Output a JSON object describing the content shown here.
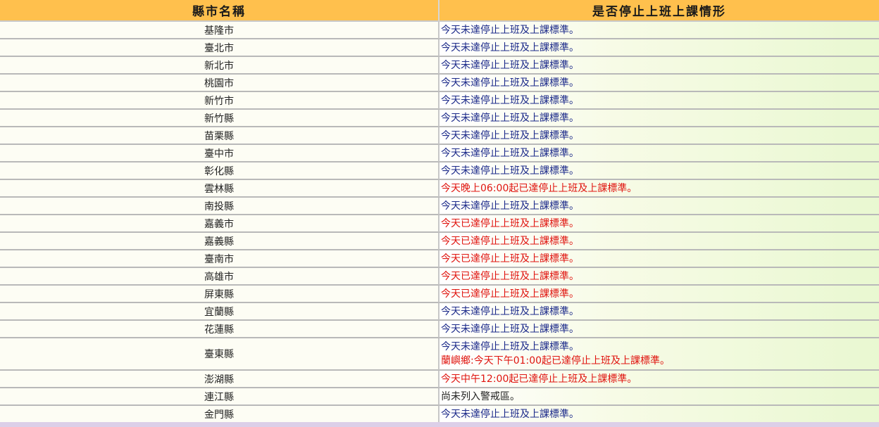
{
  "header": {
    "col_county": "縣市名稱",
    "col_status": "是否停止上班上課情形"
  },
  "rows": [
    {
      "county": "基隆市",
      "lines": [
        {
          "text": "今天未達停止上班及上課標準。",
          "tone": "ok"
        }
      ]
    },
    {
      "county": "臺北市",
      "lines": [
        {
          "text": "今天未達停止上班及上課標準。",
          "tone": "ok"
        }
      ]
    },
    {
      "county": "新北市",
      "lines": [
        {
          "text": "今天未達停止上班及上課標準。",
          "tone": "ok"
        }
      ]
    },
    {
      "county": "桃園市",
      "lines": [
        {
          "text": "今天未達停止上班及上課標準。",
          "tone": "ok"
        }
      ]
    },
    {
      "county": "新竹市",
      "lines": [
        {
          "text": "今天未達停止上班及上課標準。",
          "tone": "ok"
        }
      ]
    },
    {
      "county": "新竹縣",
      "lines": [
        {
          "text": "今天未達停止上班及上課標準。",
          "tone": "ok"
        }
      ]
    },
    {
      "county": "苗栗縣",
      "lines": [
        {
          "text": "今天未達停止上班及上課標準。",
          "tone": "ok"
        }
      ]
    },
    {
      "county": "臺中市",
      "lines": [
        {
          "text": "今天未達停止上班及上課標準。",
          "tone": "ok"
        }
      ]
    },
    {
      "county": "彰化縣",
      "lines": [
        {
          "text": "今天未達停止上班及上課標準。",
          "tone": "ok"
        }
      ]
    },
    {
      "county": "雲林縣",
      "lines": [
        {
          "text": "今天晚上06:00起已達停止上班及上課標準。",
          "tone": "warn"
        }
      ]
    },
    {
      "county": "南投縣",
      "lines": [
        {
          "text": "今天未達停止上班及上課標準。",
          "tone": "ok"
        }
      ]
    },
    {
      "county": "嘉義市",
      "lines": [
        {
          "text": "今天已達停止上班及上課標準。",
          "tone": "warn"
        }
      ]
    },
    {
      "county": "嘉義縣",
      "lines": [
        {
          "text": "今天已達停止上班及上課標準。",
          "tone": "warn"
        }
      ]
    },
    {
      "county": "臺南市",
      "lines": [
        {
          "text": "今天已達停止上班及上課標準。",
          "tone": "warn"
        }
      ]
    },
    {
      "county": "高雄市",
      "lines": [
        {
          "text": "今天已達停止上班及上課標準。",
          "tone": "warn"
        }
      ]
    },
    {
      "county": "屏東縣",
      "lines": [
        {
          "text": "今天已達停止上班及上課標準。",
          "tone": "warn"
        }
      ]
    },
    {
      "county": "宜蘭縣",
      "lines": [
        {
          "text": "今天未達停止上班及上課標準。",
          "tone": "ok"
        }
      ]
    },
    {
      "county": "花蓮縣",
      "lines": [
        {
          "text": "今天未達停止上班及上課標準。",
          "tone": "ok"
        }
      ]
    },
    {
      "county": "臺東縣",
      "lines": [
        {
          "text": "今天未達停止上班及上課標準。",
          "tone": "ok"
        },
        {
          "text": "蘭嶼鄉:今天下午01:00起已達停止上班及上課標準。",
          "tone": "warn"
        }
      ]
    },
    {
      "county": "澎湖縣",
      "lines": [
        {
          "text": "今天中午12:00起已達停止上班及上課標準。",
          "tone": "warn"
        }
      ]
    },
    {
      "county": "連江縣",
      "lines": [
        {
          "text": "尚未列入警戒區。",
          "tone": "black"
        }
      ]
    },
    {
      "county": "金門縣",
      "lines": [
        {
          "text": "今天未達停止上班及上課標準。",
          "tone": "ok"
        }
      ]
    }
  ],
  "colors": {
    "header_bg": "#ffc04d",
    "ok_text": "#1c2a8a",
    "warn_text": "#e0140f"
  }
}
